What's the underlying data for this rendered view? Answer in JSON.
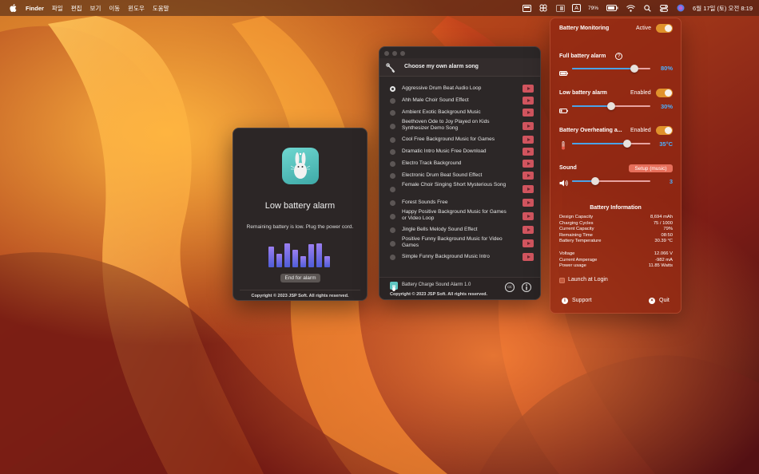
{
  "menubar": {
    "apple": "",
    "app": "Finder",
    "menus": [
      "파일",
      "편집",
      "보기",
      "이동",
      "윈도우",
      "도움말"
    ],
    "input_source": "A",
    "battery_percent": "79%",
    "datetime": "6월 17일 (토) 오전 8:19"
  },
  "alarm_window": {
    "title": "Low battery alarm",
    "message": "Remaining battery is low. Plug the power cord.",
    "end_button": "End for alarm",
    "copyright": "Copyright © 2023 JSP Soft. All rights reserved.",
    "equalizer_levels": [
      0.72,
      0.48,
      0.82,
      0.62,
      0.4,
      0.8,
      0.82,
      0.38
    ]
  },
  "songs_window": {
    "title": "Choose my own alarm song",
    "songs": [
      {
        "name": "Aggressive Drum Beat Audio Loop",
        "selected": true
      },
      {
        "name": "Ahh Male Choir Sound Effect",
        "selected": false
      },
      {
        "name": "Ambient Exotic Background Music",
        "selected": false
      },
      {
        "name": "Beethoven Ode to Joy Played on Kids Synthesizer Demo Song",
        "selected": false
      },
      {
        "name": "Cool Free Background Music for Games",
        "selected": false
      },
      {
        "name": "Dramatic Intro Music Free Download",
        "selected": false
      },
      {
        "name": "Electro Track Background",
        "selected": false
      },
      {
        "name": "Electronic Drum Beat Sound Effect",
        "selected": false
      },
      {
        "name": "Female Choir Singing Short Mysterious Song",
        "selected": false
      },
      {
        "name": "Forest Sounds Free",
        "selected": false
      },
      {
        "name": "Happy Positive Background Music for Games or Video Loop",
        "selected": false
      },
      {
        "name": "Jingle Bells Melody Sound Effect",
        "selected": false
      },
      {
        "name": "Positive Funny Background Music for Video Games",
        "selected": false
      },
      {
        "name": "Simple Funny Background Music Intro",
        "selected": false
      }
    ],
    "footer_app": "Battery Charge Sound Alarm 1.0",
    "footer_copy": "Copyright © 2023 JSP Soft. All rights reserved.",
    "cc_label": "cc"
  },
  "panel": {
    "monitoring_label": "Battery Monitoring",
    "monitoring_status": "Active",
    "full_label": "Full battery alarm",
    "full_value": "80%",
    "full_level": 0.8,
    "low_label": "Low battery alarm",
    "low_status": "Enabled",
    "low_value": "30%",
    "low_level": 0.5,
    "heat_label": "Battery Overheating a...",
    "heat_status": "Enabled",
    "heat_value": "35°C",
    "heat_level": 0.7,
    "sound_label": "Sound",
    "sound_button": "Setup (music)",
    "sound_value": "3",
    "sound_level": 0.3,
    "info_title": "Battery Information",
    "info_rows_1": [
      {
        "k": "Design Capacity",
        "v": "8,694 mAh"
      },
      {
        "k": "Charging Cycles",
        "v": "75 / 1000"
      },
      {
        "k": "Current Capacity",
        "v": "79%"
      },
      {
        "k": "Remaining Time",
        "v": "08:50"
      },
      {
        "k": "Battery Temperature",
        "v": "30.39 °C"
      }
    ],
    "info_rows_2": [
      {
        "k": "Voltage",
        "v": "12.066 V"
      },
      {
        "k": "Current Amperage",
        "v": "-982 mA"
      },
      {
        "k": "Power usage",
        "v": "11.85 Watts"
      }
    ],
    "launch_label": "Launch at Login",
    "support_label": "Support",
    "quit_label": "Quit"
  }
}
